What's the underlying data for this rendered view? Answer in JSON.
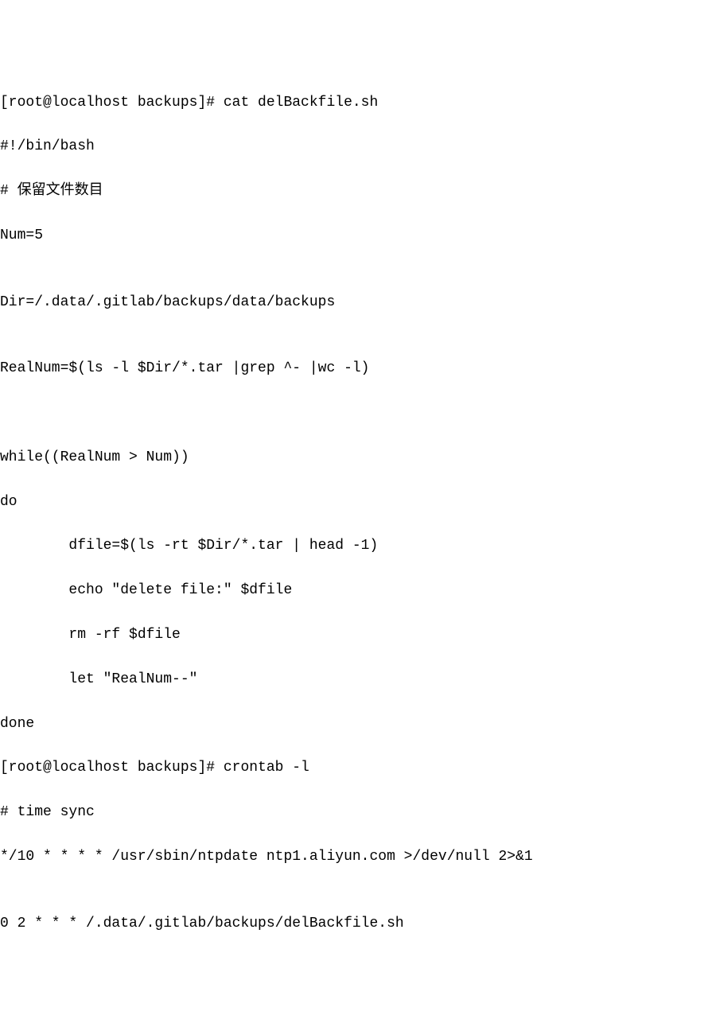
{
  "terminal": {
    "lines": [
      "[root@localhost backups]# cat delBackfile.sh",
      "#!/bin/bash",
      "# 保留文件数目",
      "Num=5",
      "",
      "Dir=/.data/.gitlab/backups/data/backups",
      "",
      "RealNum=$(ls -l $Dir/*.tar |grep ^- |wc -l)",
      "",
      "",
      "while((RealNum > Num))",
      "do",
      "        dfile=$(ls -rt $Dir/*.tar | head -1)",
      "        echo \"delete file:\" $dfile",
      "        rm -rf $dfile",
      "        let \"RealNum--\"",
      "done",
      "[root@localhost backups]# crontab -l",
      "# time sync",
      "*/10 * * * * /usr/sbin/ntpdate ntp1.aliyun.com >/dev/null 2>&1",
      "",
      "0 2 * * * /.data/.gitlab/backups/delBackfile.sh"
    ]
  }
}
